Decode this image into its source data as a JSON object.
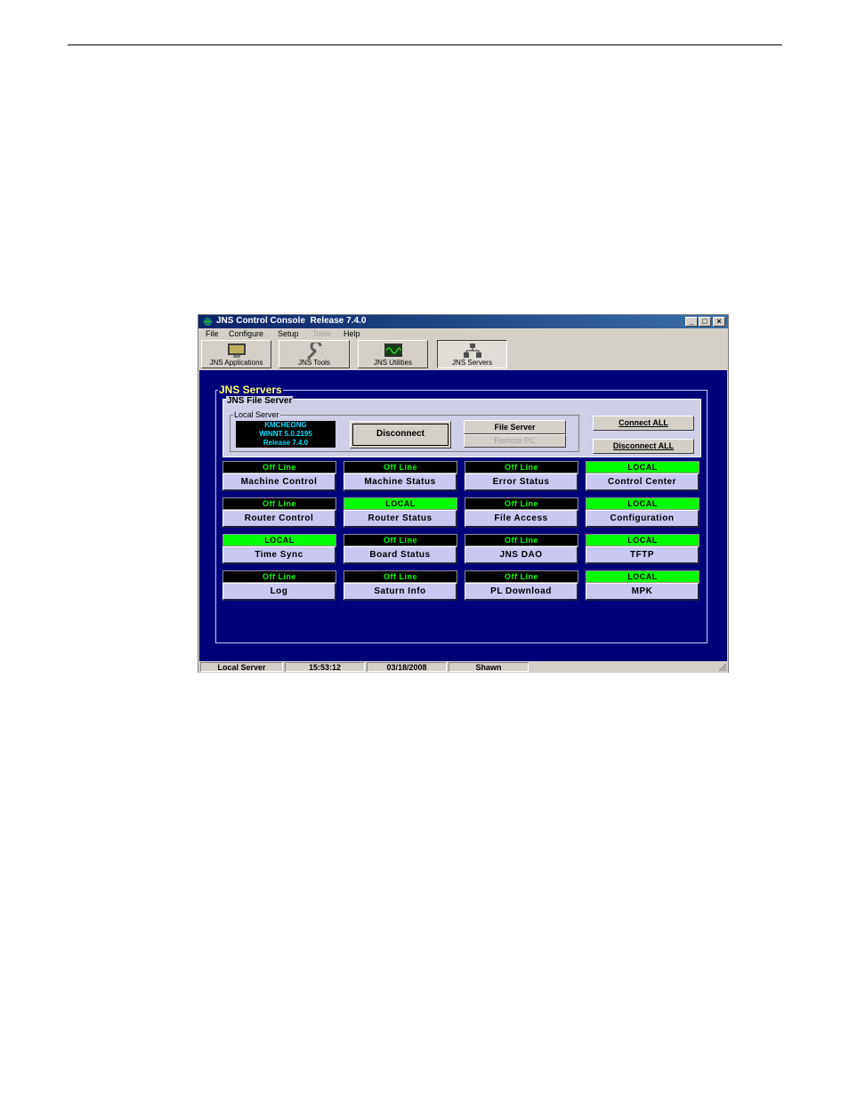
{
  "window": {
    "title": "JNS Control Console  Release 7.4.0",
    "controls": {
      "minimize": "_",
      "maximize": "□",
      "close": "×"
    }
  },
  "menu": [
    {
      "label": "File",
      "enabled": true
    },
    {
      "label": "Configure",
      "enabled": true
    },
    {
      "label": "Setup",
      "enabled": true
    },
    {
      "label": "Tools",
      "enabled": false
    },
    {
      "label": "Help",
      "enabled": true
    }
  ],
  "toolbar": [
    {
      "label": "JNS Applications",
      "icon": "monitor-icon"
    },
    {
      "label": "JNS Tools",
      "icon": "wrench-icon"
    },
    {
      "label": "JNS Utilities",
      "icon": "oscilloscope-icon"
    },
    {
      "label": "JNS Servers",
      "icon": "servers-icon",
      "active": true
    }
  ],
  "servers_group": {
    "title": "JNS Servers"
  },
  "file_server": {
    "title": "JNS File Server",
    "local_server": {
      "title": "Local Server",
      "host": "KMCHEONG",
      "os": "WINNT 5.0.2195",
      "release": "Release 7.4.0"
    },
    "disconnect_label": "Disconnect",
    "file_server_label": "File Server",
    "remote_pc_label": "Remote PC",
    "connect_all_label": "Connect ALL",
    "disconnect_all_label": "Disconnect ALL"
  },
  "tiles": [
    {
      "status": "Off Line",
      "label": "Machine Control"
    },
    {
      "status": "Off Line",
      "label": "Machine Status"
    },
    {
      "status": "Off Line",
      "label": "Error Status"
    },
    {
      "status": "LOCAL",
      "label": "Control Center"
    },
    {
      "status": "Off Line",
      "label": "Router Control"
    },
    {
      "status": "LOCAL",
      "label": "Router Status"
    },
    {
      "status": "Off Line",
      "label": "File Access"
    },
    {
      "status": "LOCAL",
      "label": "Configuration"
    },
    {
      "status": "LOCAL",
      "label": "Time Sync"
    },
    {
      "status": "Off Line",
      "label": "Board Status"
    },
    {
      "status": "Off Line",
      "label": "JNS DAO"
    },
    {
      "status": "LOCAL",
      "label": "TFTP"
    },
    {
      "status": "Off Line",
      "label": "Log"
    },
    {
      "status": "Off Line",
      "label": "Saturn Info"
    },
    {
      "status": "Off Line",
      "label": "PL Download"
    },
    {
      "status": "LOCAL",
      "label": "MPK"
    }
  ],
  "statusbar": {
    "server": "Local Server",
    "time": "15:53:12",
    "date": "03/18/2008",
    "user": "Shawn"
  },
  "colors": {
    "client_bg": "#00007a",
    "offline_bg": "#000000",
    "offline_text": "#00ff00",
    "local_bg": "#00ff00",
    "title_yellow": "#ffff66"
  }
}
